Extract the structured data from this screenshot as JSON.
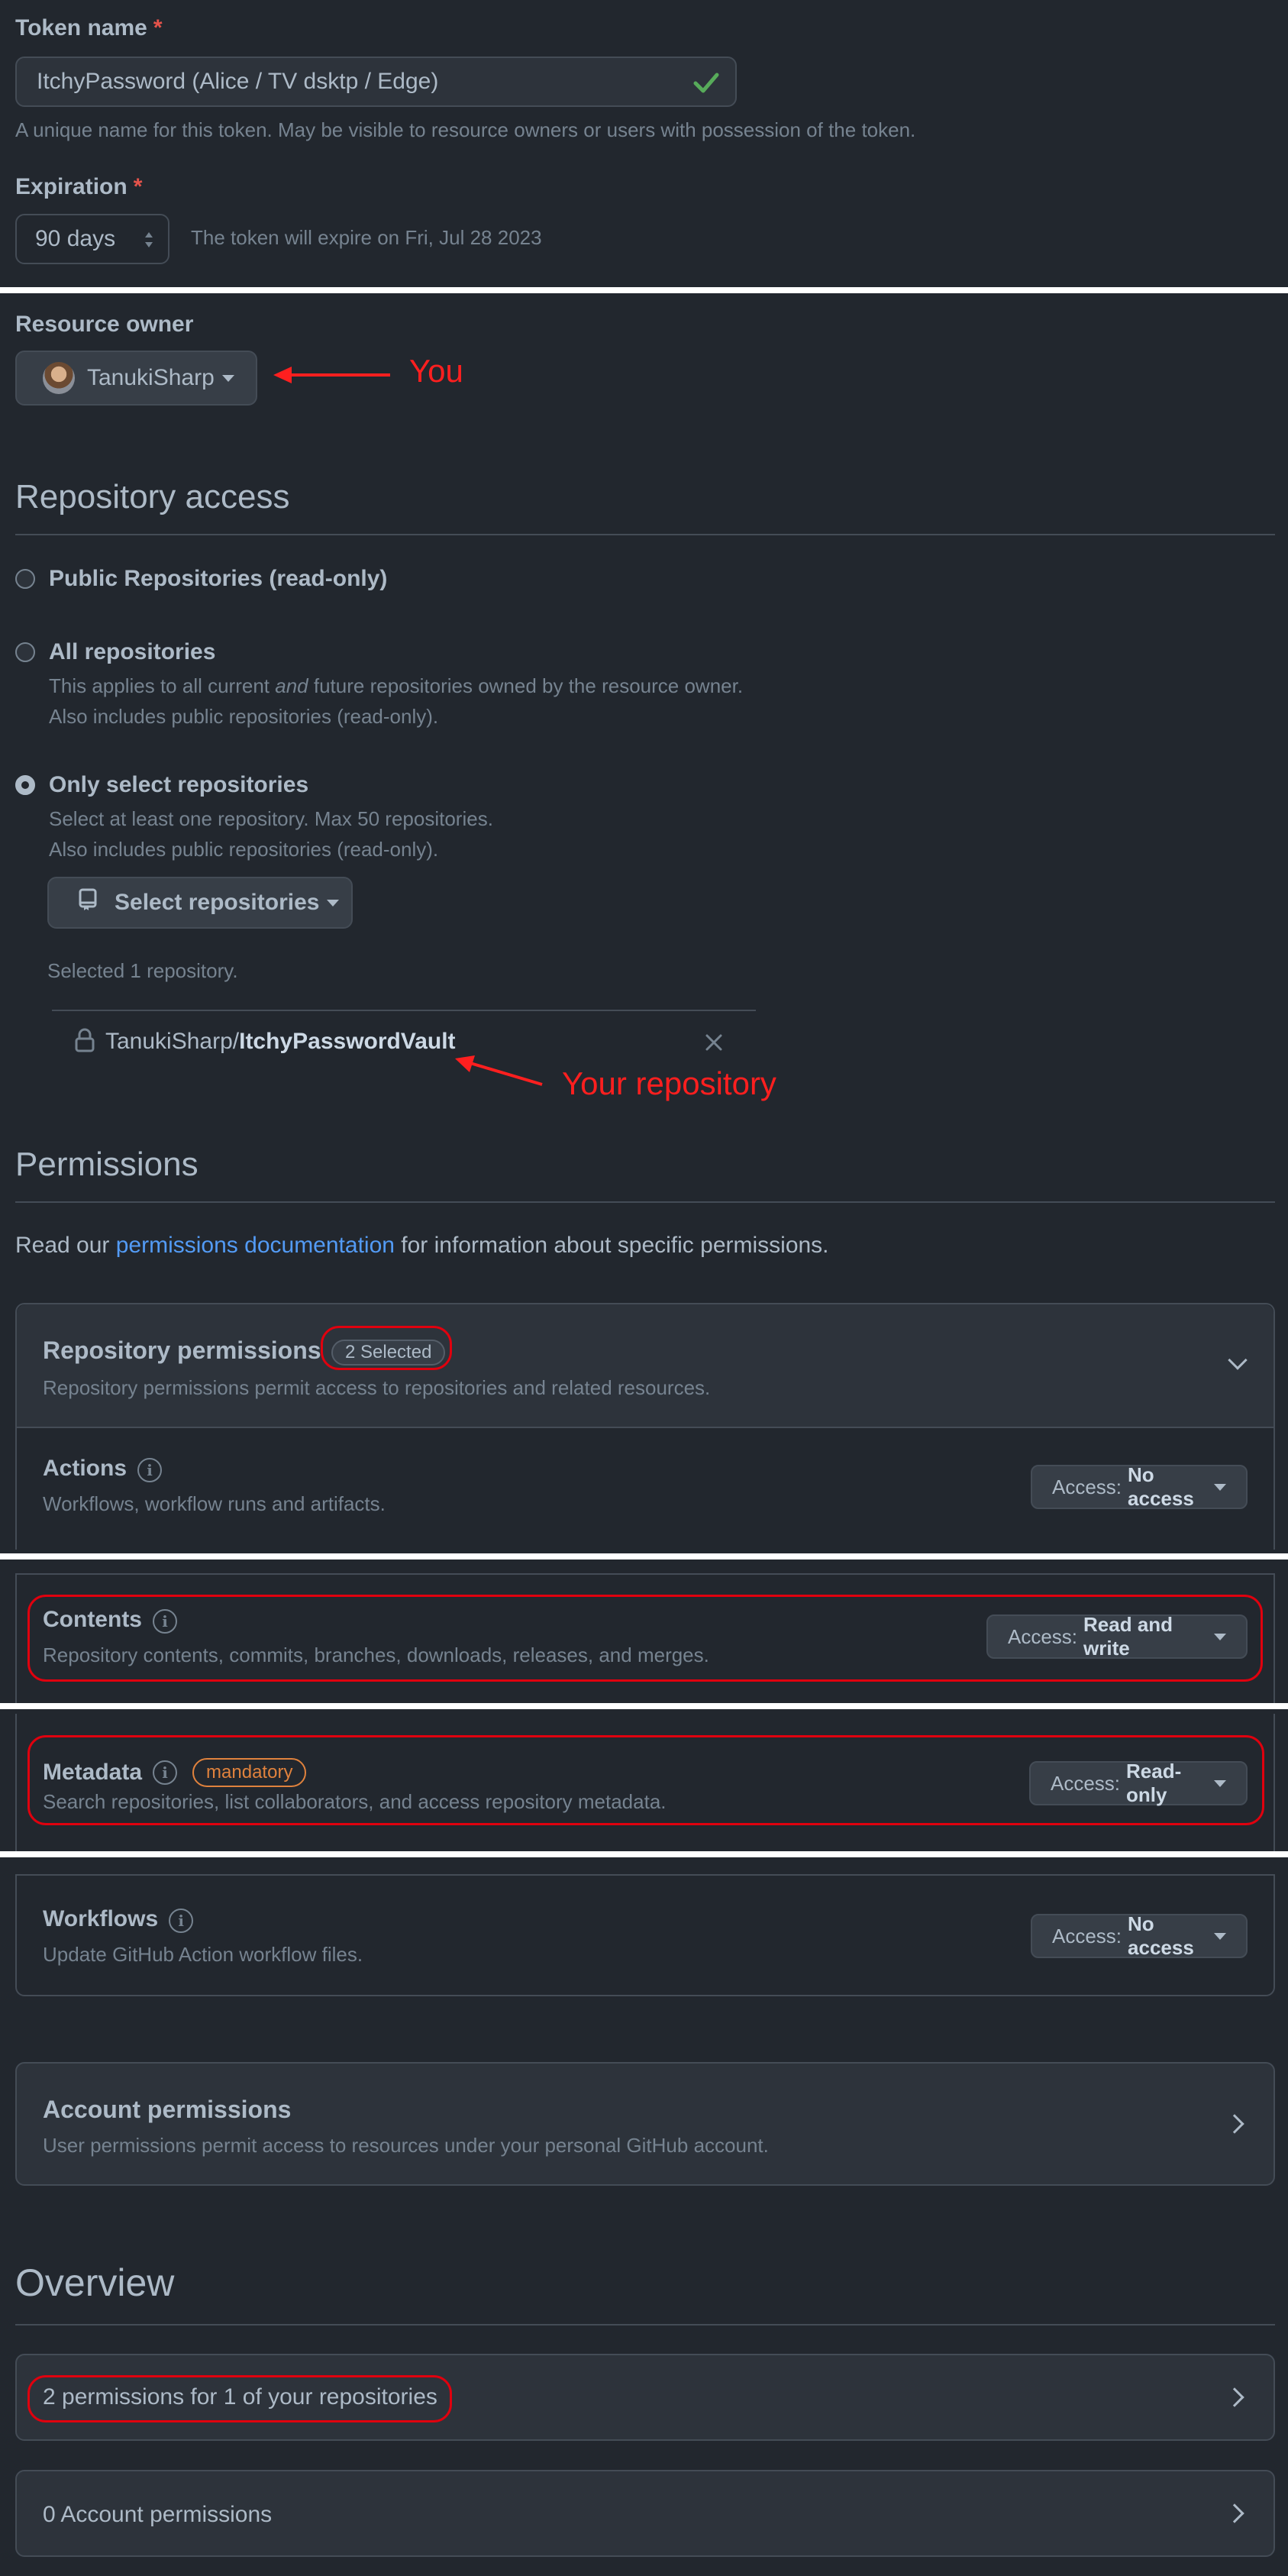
{
  "token": {
    "name_label": "Token name",
    "required_mark": "*",
    "name_value": "ItchyPassword (Alice / TV dsktp / Edge)",
    "name_hint": "A unique name for this token. May be visible to resource owners or users with possession of the token.",
    "expiration_label": "Expiration",
    "expiration_value": "90 days",
    "expiration_hint": "The token will expire on Fri, Jul 28 2023"
  },
  "resource_owner": {
    "label": "Resource owner",
    "owner": "TanukiSharp",
    "annotation": "You"
  },
  "repository_access": {
    "heading": "Repository access",
    "options": [
      {
        "title": "Public Repositories (read-only)",
        "selected": false
      },
      {
        "title": "All repositories",
        "desc_1_pre": "This applies to all current ",
        "desc_1_em": "and",
        "desc_1_post": " future repositories owned by the resource owner.",
        "desc_2": "Also includes public repositories (read-only).",
        "selected": false
      },
      {
        "title": "Only select repositories",
        "desc_1": "Select at least one repository. Max 50 repositories.",
        "desc_2": "Also includes public repositories (read-only).",
        "selected": true
      }
    ],
    "select_button": "Select repositories",
    "selected_count": "Selected 1 repository.",
    "repo_owner": "TanukiSharp/",
    "repo_name": "ItchyPasswordVault",
    "annotation": "Your repository"
  },
  "permissions": {
    "heading": "Permissions",
    "intro_pre": "Read our ",
    "intro_link": "permissions documentation",
    "intro_post": " for information about specific permissions.",
    "repo_panel": {
      "title": "Repository permissions",
      "badge": "2 Selected",
      "desc": "Repository permissions permit access to repositories and related resources."
    },
    "items": [
      {
        "name": "Actions",
        "desc": "Workflows, workflow runs and artifacts.",
        "access_prefix": "Access:",
        "access": "No access"
      },
      {
        "name": "Contents",
        "desc": "Repository contents, commits, branches, downloads, releases, and merges.",
        "access_prefix": "Access:",
        "access": "Read and write"
      },
      {
        "name": "Metadata",
        "badge": "mandatory",
        "desc": "Search repositories, list collaborators, and access repository metadata.",
        "access_prefix": "Access:",
        "access": "Read-only"
      },
      {
        "name": "Workflows",
        "desc": "Update GitHub Action workflow files.",
        "access_prefix": "Access:",
        "access": "No access"
      }
    ],
    "account_panel": {
      "title": "Account permissions",
      "desc": "User permissions permit access to resources under your personal GitHub account."
    }
  },
  "overview": {
    "heading": "Overview",
    "repo_summary": "2 permissions for 1 of your repositories",
    "account_summary": "0 Account permissions"
  },
  "colors": {
    "background": "#22272e",
    "annotation": "#ff1f1f",
    "link": "#539bf5",
    "success": "#57ab5a",
    "mandatory": "#e0823d"
  }
}
